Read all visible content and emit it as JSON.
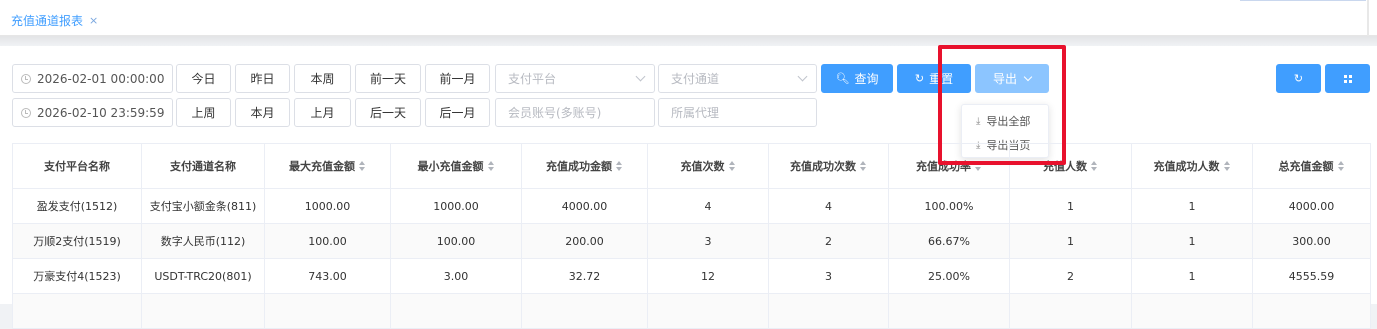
{
  "tab": {
    "label": "充值通道报表",
    "close": "×"
  },
  "filters": {
    "start_time": "2026-02-01 00:00:00",
    "end_time": "2026-02-10 23:59:59",
    "platform_placeholder": "支付平台",
    "channel_placeholder": "支付通道",
    "account_placeholder": "会员账号(多账号)",
    "agent_placeholder": "所属代理"
  },
  "quick_buttons_row1": [
    "今日",
    "昨日",
    "本周",
    "前一天",
    "前一月"
  ],
  "quick_buttons_row2": [
    "上周",
    "本月",
    "上月",
    "后一天",
    "后一月"
  ],
  "actions": {
    "query": "查询",
    "reset": "重置",
    "export": "导出"
  },
  "export_menu": [
    "导出全部",
    "导出当页"
  ],
  "table": {
    "columns": [
      "支付平台名称",
      "支付通道名称",
      "最大充值金额",
      "最小充值金额",
      "充值成功金额",
      "充值次数",
      "充值成功次数",
      "充值成功率",
      "充值人数",
      "充值成功人数",
      "总充值金额"
    ],
    "rows": [
      [
        "盈发支付(1512)",
        "支付宝小额金条(811)",
        "1000.00",
        "1000.00",
        "4000.00",
        "4",
        "4",
        "100.00%",
        "1",
        "1",
        "4000.00"
      ],
      [
        "万顺2支付(1519)",
        "数字人民币(112)",
        "100.00",
        "100.00",
        "200.00",
        "3",
        "2",
        "66.67%",
        "1",
        "1",
        "300.00"
      ],
      [
        "万豪支付4(1523)",
        "USDT-TRC20(801)",
        "743.00",
        "3.00",
        "32.72",
        "12",
        "3",
        "25.00%",
        "2",
        "1",
        "4555.59"
      ]
    ]
  },
  "colors": {
    "primary": "#409eff",
    "primary_light": "#8cc5ff",
    "highlight": "#e8112d"
  }
}
